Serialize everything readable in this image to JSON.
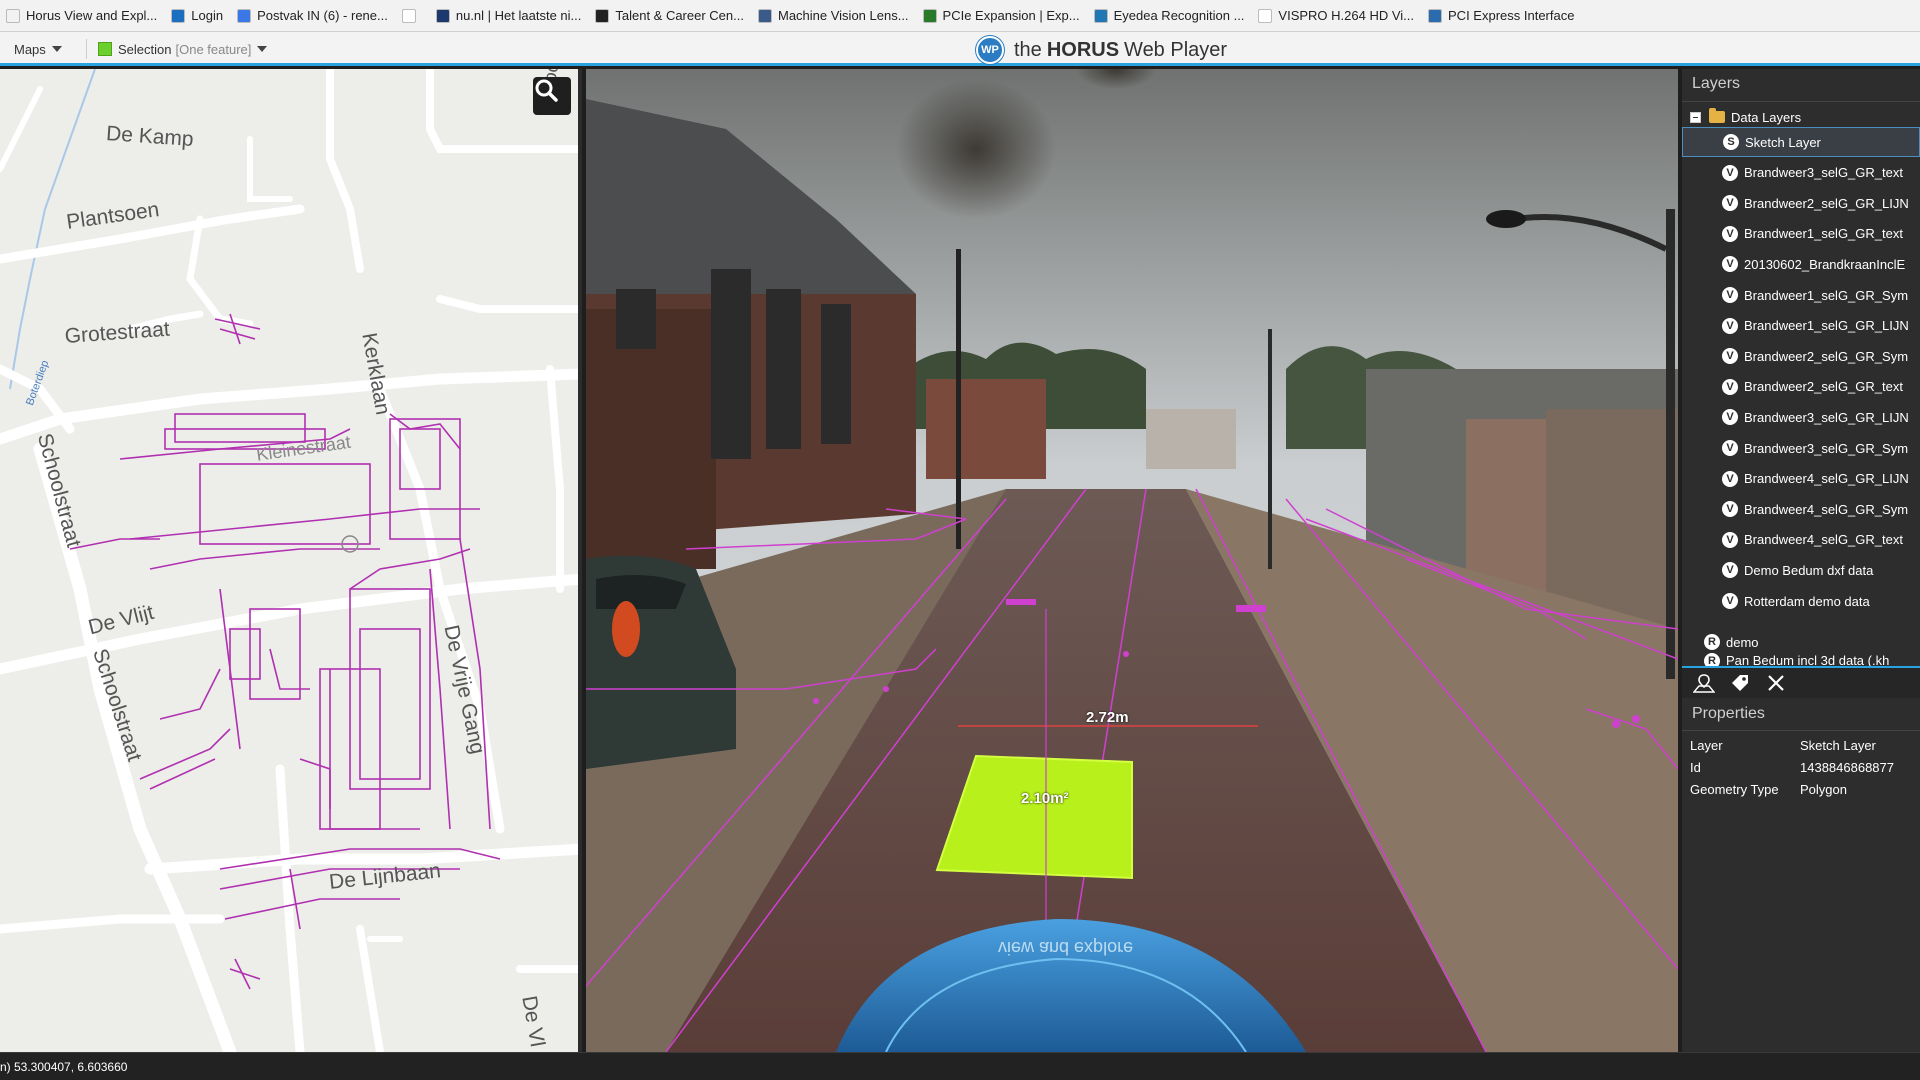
{
  "bookmarks": [
    {
      "label": "Horus View and Expl...",
      "icon": "page-icon",
      "color": "#f2f2f2"
    },
    {
      "label": "Login",
      "icon": "login-icon",
      "color": "#1a6fc0"
    },
    {
      "label": "Postvak IN (6) - rene...",
      "icon": "mail-icon",
      "color": "#3b78e7"
    },
    {
      "label": "",
      "icon": "blank-page-icon",
      "color": "#ffffff"
    },
    {
      "label": "nu.nl | Het laatste ni...",
      "icon": "nu-icon",
      "color": "#1b3a6b"
    },
    {
      "label": "Talent & Career Cen...",
      "icon": "chart-icon",
      "color": "#222222"
    },
    {
      "label": "Machine Vision Lens...",
      "icon": "camera-icon",
      "color": "#3a5a8a"
    },
    {
      "label": "PCIe Expansion | Exp...",
      "icon": "board-icon",
      "color": "#2a7a2a"
    },
    {
      "label": "Eyedea Recognition ...",
      "icon": "eye-icon",
      "color": "#1f78b4"
    },
    {
      "label": "VISPRO H.264 HD Vi...",
      "icon": "page-icon",
      "color": "#ffffff"
    },
    {
      "label": "PCI Express Interface",
      "icon": "pci-icon",
      "color": "#2b6cb0"
    }
  ],
  "toolbar": {
    "maps_label": "Maps",
    "selection_label": "Selection",
    "selection_count": "[One feature]",
    "title_prefix": "the",
    "title_bold": "HORUS",
    "title_suffix": "Web Player",
    "logo_text": "WP"
  },
  "map": {
    "streets": [
      "De Kamp",
      "Plantsoen",
      "Grotestraat",
      "Kerklaan",
      "Kleinestraat",
      "Schoolstraat",
      "De Vlijt",
      "Schoolstraat",
      "De Vrije Gang",
      "De Lijnbaan",
      "De Vl",
      "Groot",
      "Boterdiep"
    ]
  },
  "viewer": {
    "distance_label": "2.72m",
    "area_label": "2.10m²",
    "hood_text": "view and explore"
  },
  "layers": {
    "title": "Layers",
    "root_label": "Data Layers",
    "items": [
      {
        "label": "Sketch Layer",
        "badge": "S"
      },
      {
        "label": "Brandweer3_selG_GR_text",
        "badge": "V"
      },
      {
        "label": "Brandweer2_selG_GR_LIJN",
        "badge": "V"
      },
      {
        "label": "Brandweer1_selG_GR_text",
        "badge": "V"
      },
      {
        "label": "20130602_BrandkraanInclE",
        "badge": "V"
      },
      {
        "label": "Brandweer1_selG_GR_Sym",
        "badge": "V"
      },
      {
        "label": "Brandweer1_selG_GR_LIJN",
        "badge": "V"
      },
      {
        "label": "Brandweer2_selG_GR_Sym",
        "badge": "V"
      },
      {
        "label": "Brandweer2_selG_GR_text",
        "badge": "V"
      },
      {
        "label": "Brandweer3_selG_GR_LIJN",
        "badge": "V"
      },
      {
        "label": "Brandweer3_selG_GR_Sym",
        "badge": "V"
      },
      {
        "label": "Brandweer4_selG_GR_LIJN",
        "badge": "V"
      },
      {
        "label": "Brandweer4_selG_GR_Sym",
        "badge": "V"
      },
      {
        "label": "Brandweer4_selG_GR_text",
        "badge": "V"
      },
      {
        "label": "Demo Bedum dxf data",
        "badge": "V"
      },
      {
        "label": "Rotterdam demo data",
        "badge": "V"
      }
    ],
    "demo_label": "demo",
    "demo_badge": "R",
    "partial_label": "Pan Bedum incl 3d data (.kh"
  },
  "properties": {
    "title": "Properties",
    "rows": [
      {
        "key": "Layer",
        "value": "Sketch Layer"
      },
      {
        "key": "Id",
        "value": "1438846868877"
      },
      {
        "key": "Geometry Type",
        "value": "Polygon"
      }
    ]
  },
  "status": {
    "coords": "n) 53.300407, 6.603660"
  },
  "colors": {
    "accent": "#29a3e0",
    "overlay": "#cc33cc",
    "area_fill": "#b7f01a",
    "panel_bg": "#2d2d2d"
  }
}
